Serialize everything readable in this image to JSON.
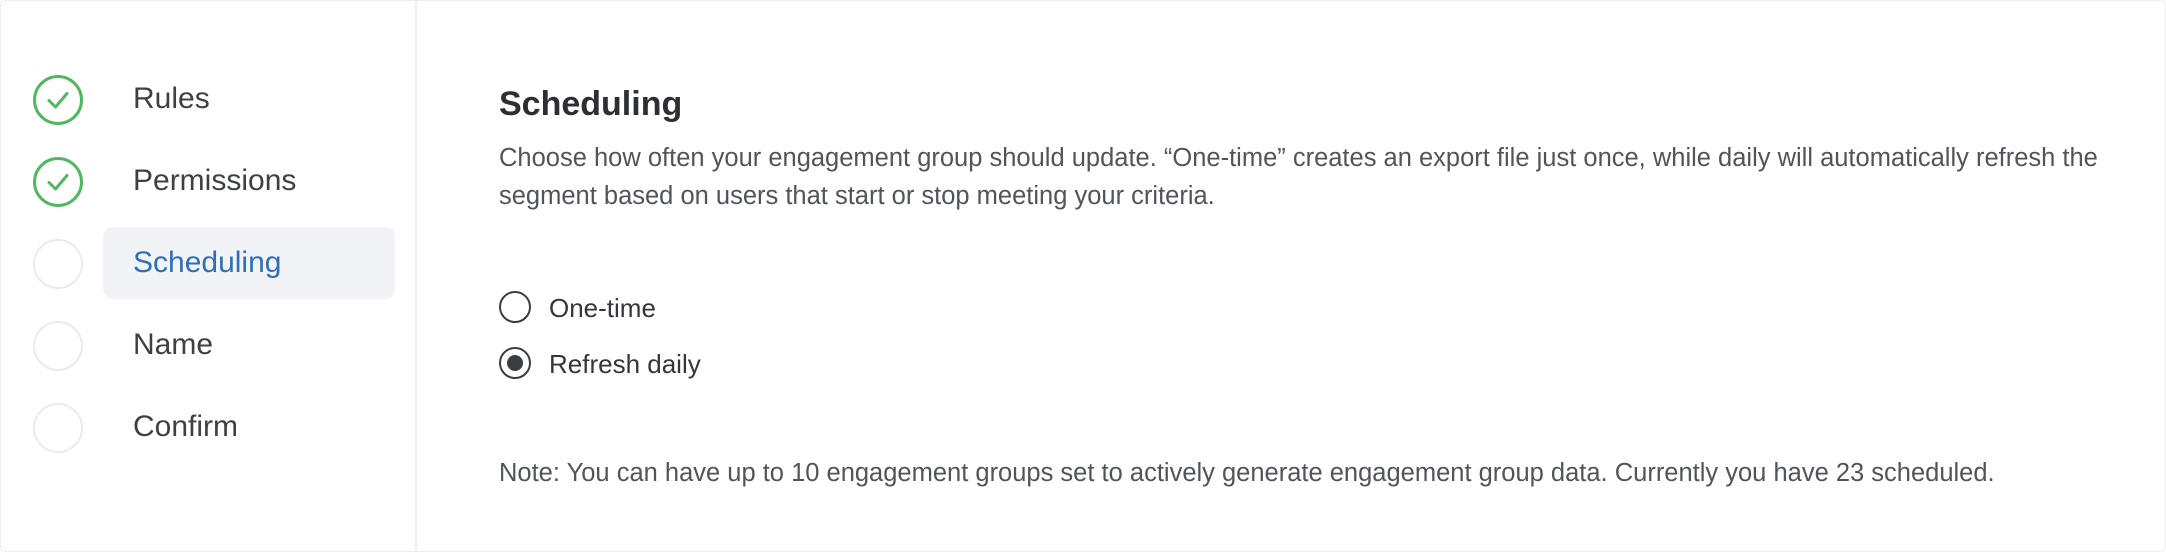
{
  "sidebar": {
    "steps": [
      {
        "label": "Rules",
        "status": "complete",
        "icon": "check-circle-icon"
      },
      {
        "label": "Permissions",
        "status": "complete",
        "icon": "check-circle-icon"
      },
      {
        "label": "Scheduling",
        "status": "current",
        "icon": "empty-circle-icon"
      },
      {
        "label": "Name",
        "status": "pending",
        "icon": "empty-circle-icon"
      },
      {
        "label": "Confirm",
        "status": "pending",
        "icon": "empty-circle-icon"
      }
    ]
  },
  "main": {
    "title": "Scheduling",
    "description": "Choose how often your engagement group should update. “One-time” creates an export file just once, while daily will automatically refresh the segment based on users that start or stop meeting your criteria.",
    "options": [
      {
        "label": "One-time",
        "selected": false
      },
      {
        "label": "Refresh daily",
        "selected": true
      }
    ],
    "note": "Note: You can have up to 10 engagement groups set to actively generate engagement group data. Currently you have 23 scheduled."
  },
  "colors": {
    "complete": "#52b662",
    "active_text": "#2e6fba",
    "active_bg": "#f1f3f6"
  }
}
